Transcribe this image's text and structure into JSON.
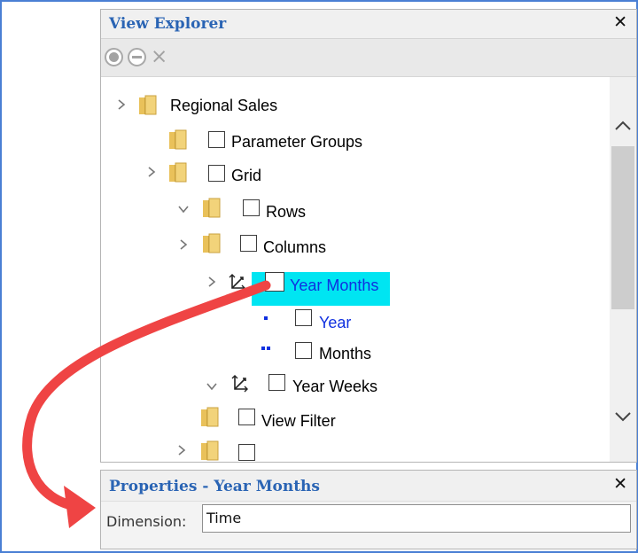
{
  "explorer": {
    "title": "View Explorer",
    "close": "✕",
    "toolbar": {
      "clear_icon": "×"
    },
    "tree": [
      {
        "label": "Regional Sales",
        "expand": "collapsed",
        "kind": "folder",
        "checkbox": false
      },
      {
        "label": "Parameter Groups",
        "expand": "none",
        "kind": "folder",
        "checkbox": true
      },
      {
        "label": "Grid",
        "expand": "collapsed",
        "kind": "folder",
        "checkbox": true
      },
      {
        "label": "Rows",
        "expand": "expanded",
        "kind": "folder",
        "checkbox": true
      },
      {
        "label": "Columns",
        "expand": "collapsed",
        "kind": "folder",
        "checkbox": true
      },
      {
        "label": "Year Months",
        "expand": "collapsed",
        "kind": "hierarchy",
        "checkbox": true,
        "selected": true
      },
      {
        "label": "Year",
        "expand": "none",
        "kind": "level-1",
        "checkbox": true
      },
      {
        "label": "Months",
        "expand": "none",
        "kind": "level-2",
        "checkbox": true
      },
      {
        "label": "Year Weeks",
        "expand": "expanded",
        "kind": "hierarchy",
        "checkbox": true
      },
      {
        "label": "View Filter",
        "expand": "none",
        "kind": "folder",
        "checkbox": true
      },
      {
        "label": "",
        "expand": "collapsed",
        "kind": "folder",
        "checkbox": true
      }
    ]
  },
  "properties": {
    "title": "Properties - Year Months",
    "close": "✕",
    "field_label": "Dimension:",
    "field_value": "Time"
  },
  "colors": {
    "frame_border": "#4a7fd4",
    "title_blue": "#2a64b4",
    "selection": "#00e5f2",
    "link_blue": "#1030e0",
    "arrow_red": "#ef4444"
  }
}
